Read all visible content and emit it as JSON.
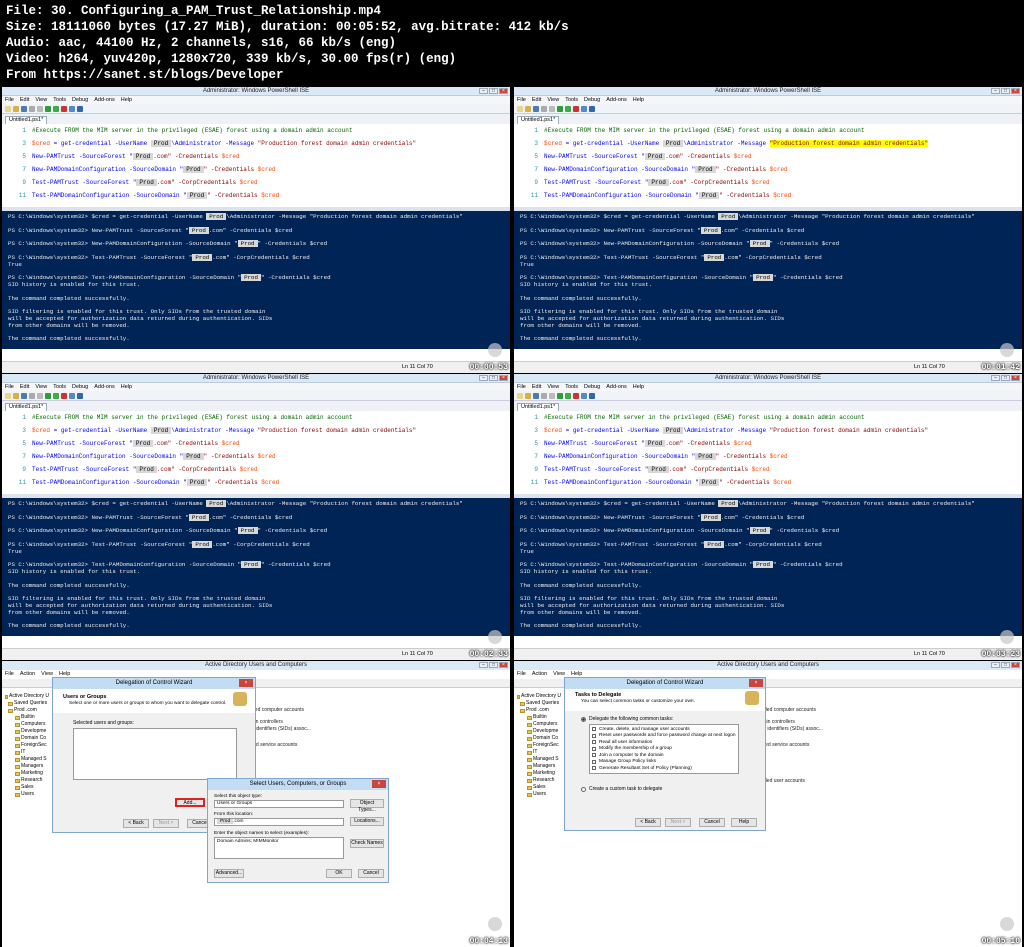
{
  "header": {
    "lines": [
      "File: 30. Configuring_a_PAM_Trust_Relationship.mp4",
      "Size: 18111060 bytes (17.27 MiB), duration: 00:05:52, avg.bitrate: 412 kb/s",
      "Audio: aac, 44100 Hz, 2 channels, s16, 66 kb/s (eng)",
      "Video: h264, yuv420p, 1280x720, 339 kb/s, 30.00 fps(r) (eng)",
      "From https://sanet.st/blogs/Developer"
    ]
  },
  "ise": {
    "title": "Administrator: Windows PowerShell ISE",
    "menu": [
      "File",
      "Edit",
      "View",
      "Tools",
      "Debug",
      "Add-ons",
      "Help"
    ],
    "tab": "Untitled1.ps1*",
    "status": "Ln 11  Col 70",
    "lines": {
      "n1": "1",
      "n3": "3",
      "n5": "5",
      "n7": "7",
      "n9": "9",
      "n11": "11",
      "comment": "#Execute FROM the MIM server in the privileged (ESAE) forest using a domain admin account",
      "l3_var": "$cred",
      "l3_mid": " = get-credential -UserName ",
      "l3_red": "Prod",
      "l3_tail": "\\Administrator -Message ",
      "l3_str": "\"Production forest domain admin credentials\"",
      "l5_cmd": "New-PAMTrust",
      "l5_arg": " -SourceForest \"",
      "l5_red": "Prod",
      "l5_tail": ".com\" -Credentials ",
      "l5_var": "$cred",
      "l7_cmd": "New-PAMDomainConfiguration",
      "l7_arg": " -SourceDomain \"",
      "l7_red": "Prod",
      "l7_tail": "\" -Credentials ",
      "l7_var": "$cred",
      "l9_cmd": "Test-PAMTrust",
      "l9_arg": " -SourceForest \"",
      "l9_red": "Prod",
      "l9_tail": ".com\" -CorpCredentials ",
      "l9_var": "$cred",
      "l11_cmd": "Test-PAMDomainConfiguration",
      "l11_arg": " -SourceDomain \"",
      "l11_red": "Prod",
      "l11_tail": "\" -Credentials ",
      "l11_var": "$cred"
    },
    "console": {
      "c1a": "PS C:\\Windows\\system32> $cred = get-credential -UserName ",
      "c1r": "Prod",
      "c1b": "\\Administrator -Message \"Production forest domain admin credentials\"",
      "c2a": "PS C:\\Windows\\system32> New-PAMTrust -SourceForest \"",
      "c2r": "Prod",
      "c2b": ".com\" -Credentials $cred",
      "c3a": "PS C:\\Windows\\system32> New-PAMDomainConfiguration -SourceDomain \"",
      "c3r": "Prod",
      "c3b": "\" -Credentials $cred",
      "c4a": "PS C:\\Windows\\system32> Test-PAMTrust -SourceForest \"",
      "c4r": "Prod",
      "c4b": ".com\" -CorpCredentials $cred",
      "c4c": "True",
      "c5a": "PS C:\\Windows\\system32> Test-PAMDomainConfiguration -SourceDomain \"",
      "c5r": "Prod",
      "c5b": "\" -Credentials $cred",
      "c6": "SID history is enabled for this trust.",
      "c7": "The command completed successfully.",
      "c8": "SID filtering is enabled for this trust. Only SIDs from the trusted domain",
      "c9": "will be accepted for authorization data returned during authentication. SIDs",
      "c10": "from other domains will be removed.",
      "c11": "The command completed successfully."
    }
  },
  "timestamps": [
    "00:00:53",
    "00:01:42",
    "00:02:33",
    "00:03:23",
    "00:04:13",
    "00:05:10"
  ],
  "aduc": {
    "title": "Active Directory Users and Computers",
    "menu": [
      "File",
      "Action",
      "View",
      "Help"
    ],
    "tree": [
      "Active Directory U",
      "Saved Queries",
      "Prod .com",
      "Builtin",
      "Computers",
      "Developme",
      "Domain Co",
      "ForeignSec",
      "IT",
      "Managed S",
      "Managers",
      "Marketing",
      "Research",
      "Sales",
      "Users"
    ],
    "right_left": [
      "pgraded computer accounts",
      "domain controllers",
      "curity identifiers (SIDs) assoc...",
      "anaged service accounts"
    ],
    "right_right": [
      "pgraded computer accounts",
      "domain controllers",
      "curity identifiers (SIDs) assoc...",
      "anaged service accounts",
      "pgraded user accounts"
    ],
    "wizard": {
      "title": "Delegation of Control Wizard",
      "users_heading": "Users or Groups",
      "users_sub": "Select one or more users or groups to whom you want to delegate control.",
      "selected_label": "Selected users and groups:",
      "add": "Add...",
      "back": "< Back",
      "next": "Next >",
      "cancel": "Cancel",
      "help": "Help",
      "tasks_heading": "Tasks to Delegate",
      "tasks_sub": "You can select common tasks or customize your own.",
      "radio1": "Delegate the following common tasks:",
      "radio2": "Create a custom task to delegate",
      "tasks": [
        "Create, delete, and manage user accounts",
        "Reset user passwords and force password change at next logon",
        "Read all user information",
        "Modify the membership of a group",
        "Join a computer to the domain",
        "Manage Group Policy links",
        "Generate Resultant Set of Policy (Planning)"
      ]
    },
    "select": {
      "title": "Select Users, Computers, or Groups",
      "type_label": "Select this object type:",
      "type_value": "Users or Groups",
      "object_types": "Object Types...",
      "loc_label": "From this location:",
      "loc_red": "Prod",
      "loc_value": ".com",
      "locations": "Locations...",
      "names_label": "Enter the object names to select (examples):",
      "names_value": "Domain Admins; MIMMonitor",
      "check_names": "Check Names",
      "advanced": "Advanced...",
      "ok": "OK",
      "cancel": "Cancel"
    }
  }
}
